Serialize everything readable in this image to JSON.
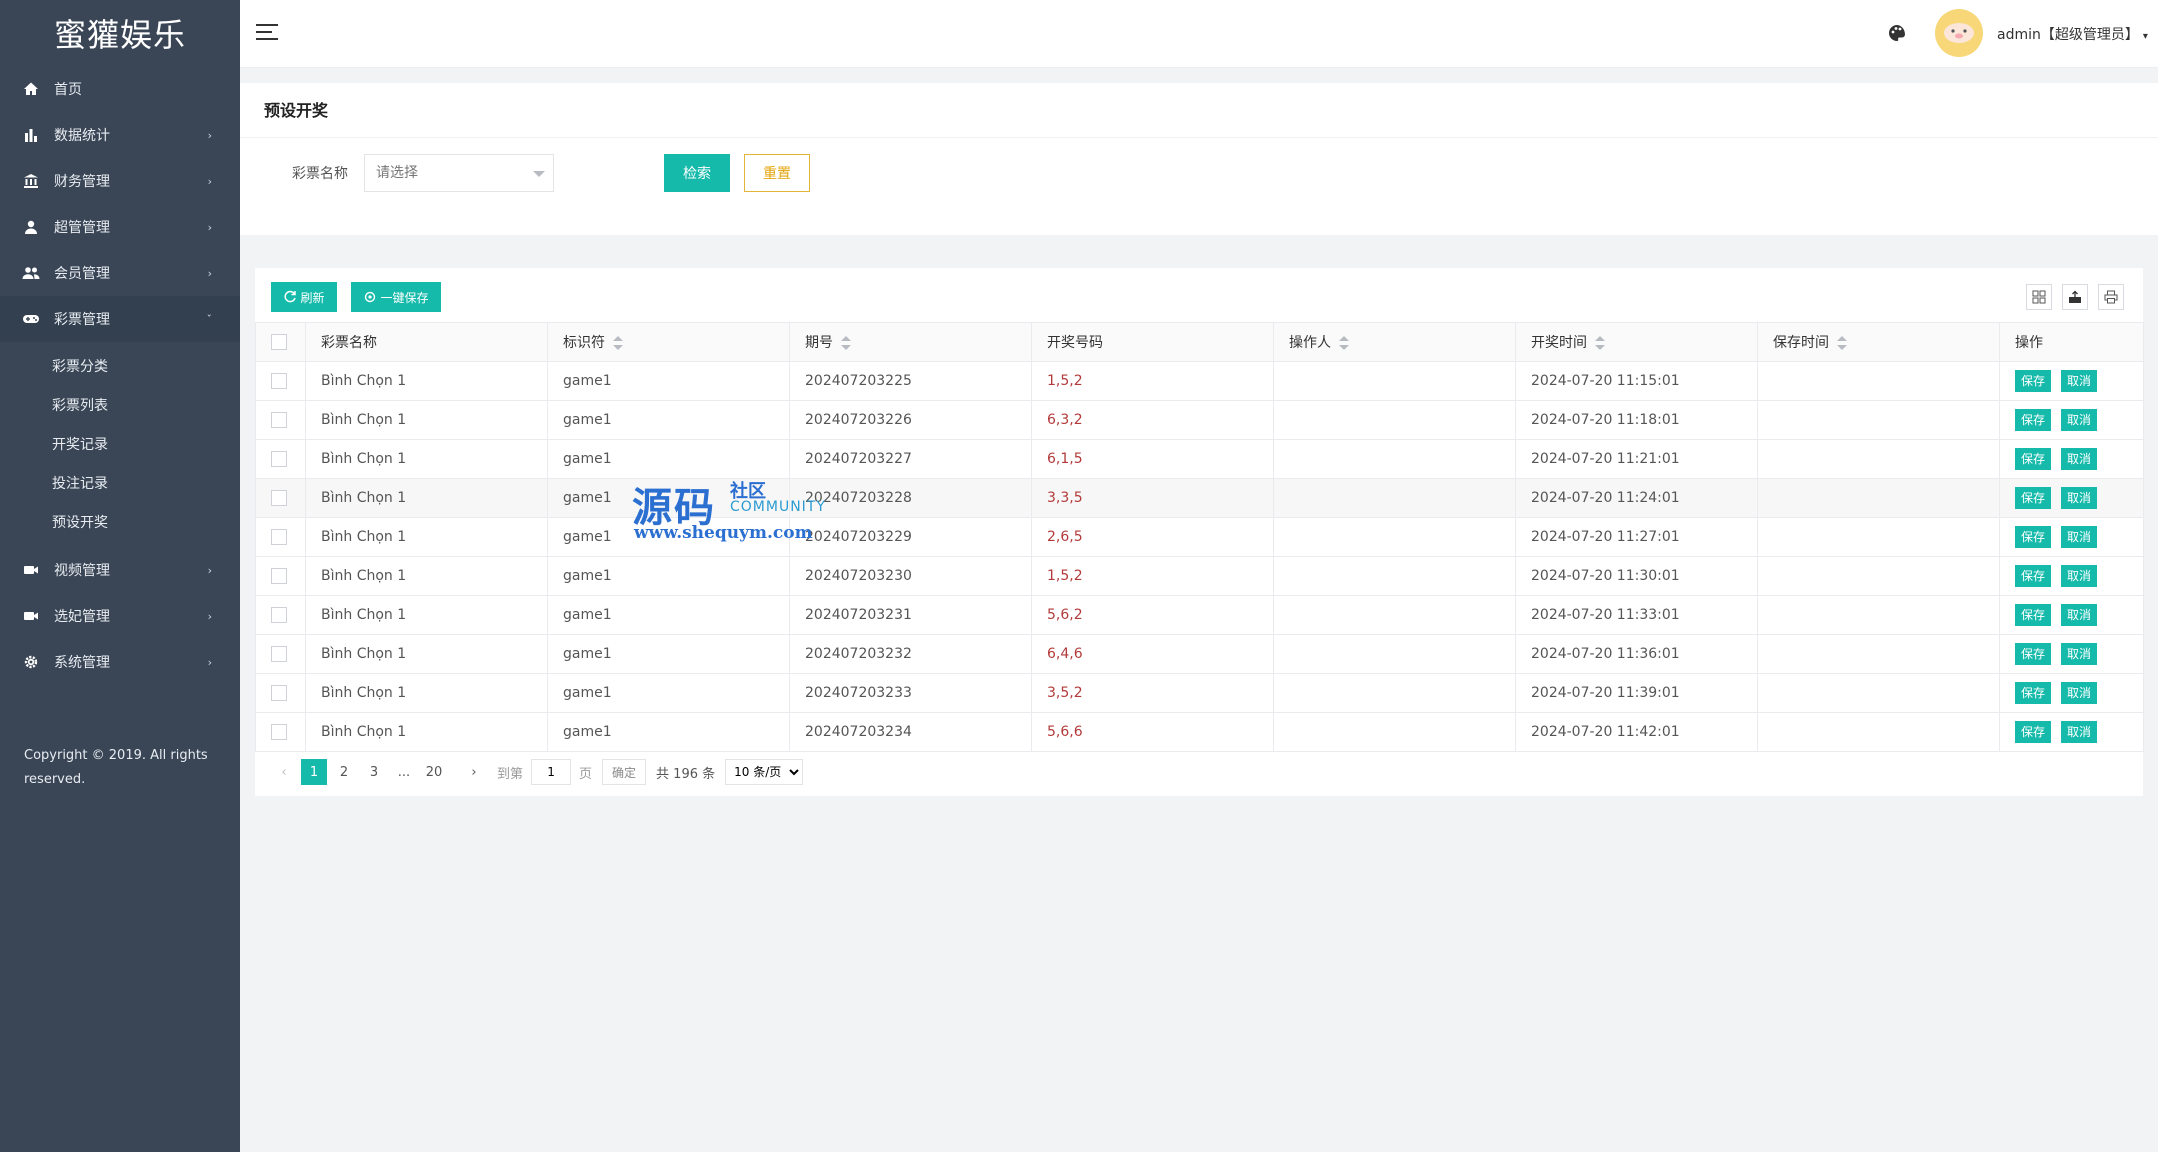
{
  "app": {
    "logo": "蜜獾娱乐"
  },
  "sidebar": {
    "items": [
      {
        "label": "首页",
        "icon": "home-icon",
        "arrow": ""
      },
      {
        "label": "数据统计",
        "icon": "bar-chart-icon",
        "arrow": "›"
      },
      {
        "label": "财务管理",
        "icon": "bank-icon",
        "arrow": "›"
      },
      {
        "label": "超管管理",
        "icon": "user-icon",
        "arrow": "›"
      },
      {
        "label": "会员管理",
        "icon": "users-icon",
        "arrow": "›"
      },
      {
        "label": "彩票管理",
        "icon": "gamepad-icon",
        "arrow": "ˇ"
      }
    ],
    "subitems": [
      "彩票分类",
      "彩票列表",
      "开奖记录",
      "投注记录",
      "预设开奖"
    ],
    "items_after": [
      {
        "label": "视频管理",
        "icon": "video-icon",
        "arrow": "›"
      },
      {
        "label": "选妃管理",
        "icon": "video-icon",
        "arrow": "›"
      },
      {
        "label": "系统管理",
        "icon": "gear-icon",
        "arrow": "›"
      }
    ],
    "copyright": "Copyright © 2019. All rights reserved."
  },
  "header": {
    "user": "admin【超级管理员】",
    "caret": "▾"
  },
  "page": {
    "title": "预设开奖",
    "filter_label": "彩票名称",
    "select_placeholder": "请选择",
    "search_label": "检索",
    "reset_label": "重置"
  },
  "toolbar": {
    "refresh_label": "刷新",
    "saveall_label": "一键保存"
  },
  "table": {
    "headers": [
      "彩票名称",
      "标识符",
      "期号",
      "开奖号码",
      "操作人",
      "开奖时间",
      "保存时间",
      "操作"
    ],
    "save_label": "保存",
    "cancel_label": "取消",
    "rows": [
      {
        "name": "Bình Chọn 1",
        "ident": "game1",
        "period": "202407203225",
        "numbers": "1,5,2",
        "operator": "",
        "draw_time": "2024-07-20 11:15:01",
        "save_time": ""
      },
      {
        "name": "Bình Chọn 1",
        "ident": "game1",
        "period": "202407203226",
        "numbers": "6,3,2",
        "operator": "",
        "draw_time": "2024-07-20 11:18:01",
        "save_time": ""
      },
      {
        "name": "Bình Chọn 1",
        "ident": "game1",
        "period": "202407203227",
        "numbers": "6,1,5",
        "operator": "",
        "draw_time": "2024-07-20 11:21:01",
        "save_time": ""
      },
      {
        "name": "Bình Chọn 1",
        "ident": "game1",
        "period": "202407203228",
        "numbers": "3,3,5",
        "operator": "",
        "draw_time": "2024-07-20 11:24:01",
        "save_time": ""
      },
      {
        "name": "Bình Chọn 1",
        "ident": "game1",
        "period": "202407203229",
        "numbers": "2,6,5",
        "operator": "",
        "draw_time": "2024-07-20 11:27:01",
        "save_time": ""
      },
      {
        "name": "Bình Chọn 1",
        "ident": "game1",
        "period": "202407203230",
        "numbers": "1,5,2",
        "operator": "",
        "draw_time": "2024-07-20 11:30:01",
        "save_time": ""
      },
      {
        "name": "Bình Chọn 1",
        "ident": "game1",
        "period": "202407203231",
        "numbers": "5,6,2",
        "operator": "",
        "draw_time": "2024-07-20 11:33:01",
        "save_time": ""
      },
      {
        "name": "Bình Chọn 1",
        "ident": "game1",
        "period": "202407203232",
        "numbers": "6,4,6",
        "operator": "",
        "draw_time": "2024-07-20 11:36:01",
        "save_time": ""
      },
      {
        "name": "Bình Chọn 1",
        "ident": "game1",
        "period": "202407203233",
        "numbers": "3,5,2",
        "operator": "",
        "draw_time": "2024-07-20 11:39:01",
        "save_time": ""
      },
      {
        "name": "Bình Chọn 1",
        "ident": "game1",
        "period": "202407203234",
        "numbers": "5,6,6",
        "operator": "",
        "draw_time": "2024-07-20 11:42:01",
        "save_time": ""
      }
    ]
  },
  "pager": {
    "pages": [
      "1",
      "2",
      "3",
      "...",
      "20"
    ],
    "goto_label": "到第",
    "goto_value": "1",
    "page_unit": "页",
    "confirm_label": "确定",
    "total_label": "共 196 条",
    "size_label": "10 条/页"
  },
  "watermark": {
    "big": "源码",
    "small": "社区",
    "comm": "COMMUNITY",
    "url": "www.shequym.com"
  },
  "colors": {
    "accent": "#16baaa",
    "sidebar": "#3a4656",
    "number": "#b33a3a",
    "reset": "#e3a50d"
  }
}
